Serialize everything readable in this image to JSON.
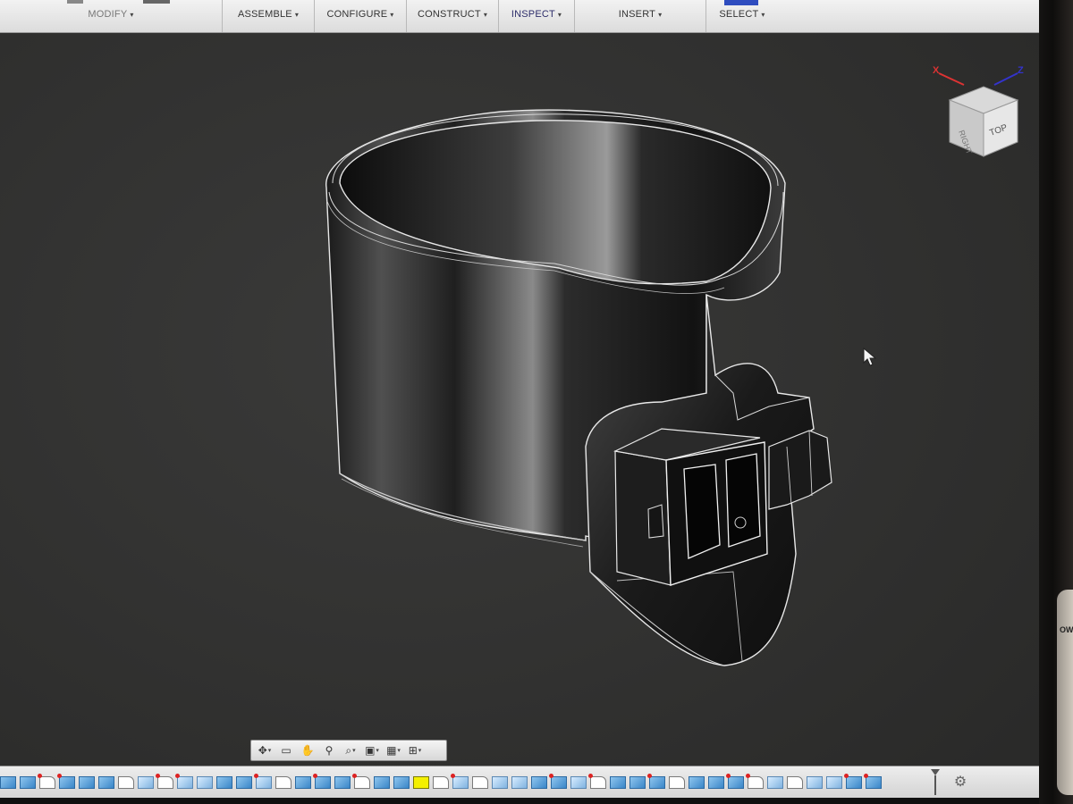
{
  "toolbar": {
    "menus": [
      {
        "label": "MODIFY"
      },
      {
        "label": "ASSEMBLE"
      },
      {
        "label": "CONFIGURE"
      },
      {
        "label": "CONSTRUCT"
      },
      {
        "label": "INSPECT"
      },
      {
        "label": "INSERT"
      },
      {
        "label": "SELECT"
      }
    ],
    "caret": "▾"
  },
  "viewcube": {
    "x_axis": "X",
    "z_axis": "Z",
    "faces": [
      "RIGHT",
      "TOP"
    ]
  },
  "navbar": {
    "tools": [
      "orbit-icon",
      "look-at-icon",
      "pan-icon",
      "zoom-icon",
      "fit-icon",
      "display-settings-icon",
      "grid-icon",
      "viewports-icon"
    ]
  },
  "timeline": {
    "feature_count": 45
  },
  "side_label": "OWB",
  "colors": {
    "background": "#333332",
    "edge": "#e8e8e8",
    "accent": "#2f4dbf",
    "highlight": "#f4f000"
  }
}
